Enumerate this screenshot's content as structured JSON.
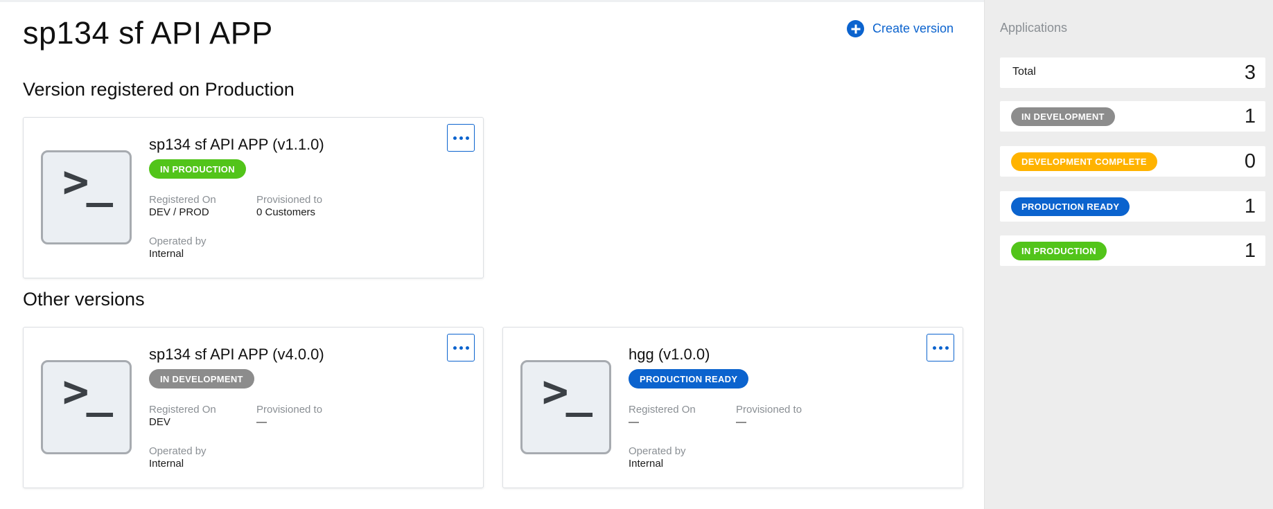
{
  "colors": {
    "accent": "#0b63ce",
    "in_production": "#52c41a",
    "in_development": "#8c8c8c",
    "development_complete": "#ffb300",
    "production_ready": "#0b63ce"
  },
  "header": {
    "title": "sp134 sf API APP",
    "create_label": "Create version",
    "create_icon": "plus-circle-icon"
  },
  "sections": {
    "production_title": "Version registered on Production",
    "other_title": "Other versions"
  },
  "icon_glyph": ">_",
  "labels": {
    "registered_on": "Registered On",
    "provisioned_to": "Provisioned to",
    "operated_by": "Operated by"
  },
  "cards": [
    {
      "name": "sp134 sf API APP (v1.1.0)",
      "status": "IN PRODUCTION",
      "registered_on": "DEV / PROD",
      "provisioned_to": "0 Customers",
      "operated_by": "Internal"
    },
    {
      "name": "sp134 sf API APP (v4.0.0)",
      "status": "IN DEVELOPMENT",
      "registered_on": "DEV",
      "provisioned_to": "—",
      "operated_by": "Internal"
    },
    {
      "name": "hgg (v1.0.0)",
      "status": "PRODUCTION READY",
      "registered_on": "—",
      "provisioned_to": "—",
      "operated_by": "Internal"
    }
  ],
  "sidebar": {
    "title": "Applications",
    "total_label": "Total",
    "total_count": "3",
    "stats": [
      {
        "label": "IN DEVELOPMENT",
        "count": "1"
      },
      {
        "label": "DEVELOPMENT COMPLETE",
        "count": "0"
      },
      {
        "label": "PRODUCTION READY",
        "count": "1"
      },
      {
        "label": "IN PRODUCTION",
        "count": "1"
      }
    ]
  }
}
